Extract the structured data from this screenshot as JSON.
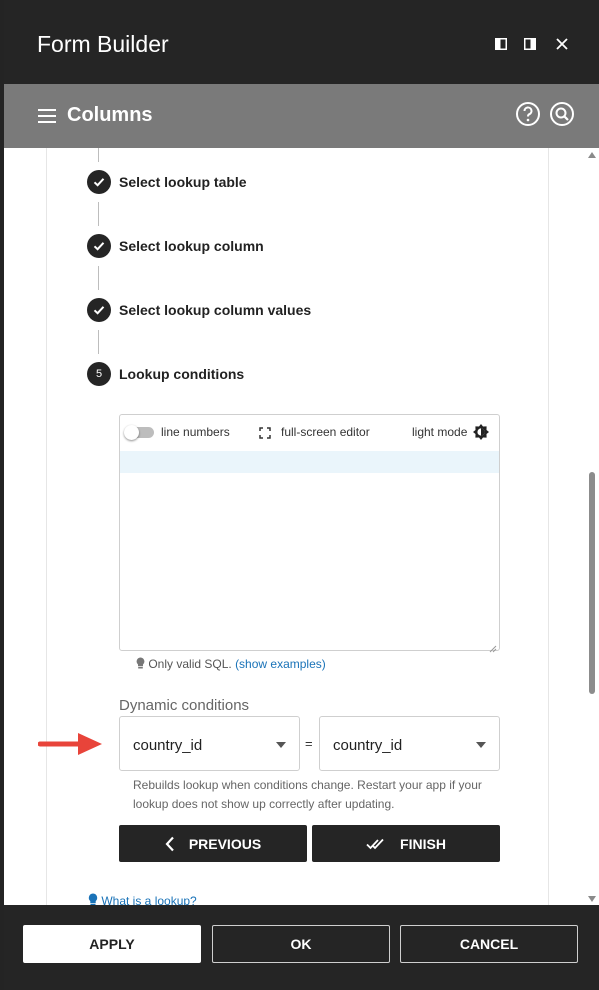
{
  "window": {
    "title": "Form Builder"
  },
  "header": {
    "title": "Columns"
  },
  "steps": [
    {
      "label": "Select lookup table",
      "done": true
    },
    {
      "label": "Select lookup column",
      "done": true
    },
    {
      "label": "Select lookup column values",
      "done": true
    },
    {
      "number": "5",
      "label": "Lookup conditions",
      "done": false
    }
  ],
  "editor": {
    "line_numbers_label": "line numbers",
    "fullscreen_label": "full-screen editor",
    "light_mode_label": "light mode"
  },
  "hint": {
    "text": "Only valid SQL.",
    "link": "(show examples)"
  },
  "dynamic": {
    "label": "Dynamic conditions",
    "left_value": "country_id",
    "operator": "=",
    "right_value": "country_id",
    "help": "Rebuilds lookup when conditions change. Restart your app if your lookup does not show up correctly after updating."
  },
  "nav": {
    "previous": "PREVIOUS",
    "finish": "FINISH"
  },
  "help_link": "What is a lookup?",
  "footer": {
    "apply": "APPLY",
    "ok": "OK",
    "cancel": "CANCEL"
  },
  "colors": {
    "dark": "#252525",
    "header_gray": "#7a7a7a",
    "link": "#1a73b8",
    "annotation_arrow": "#e8443a"
  }
}
